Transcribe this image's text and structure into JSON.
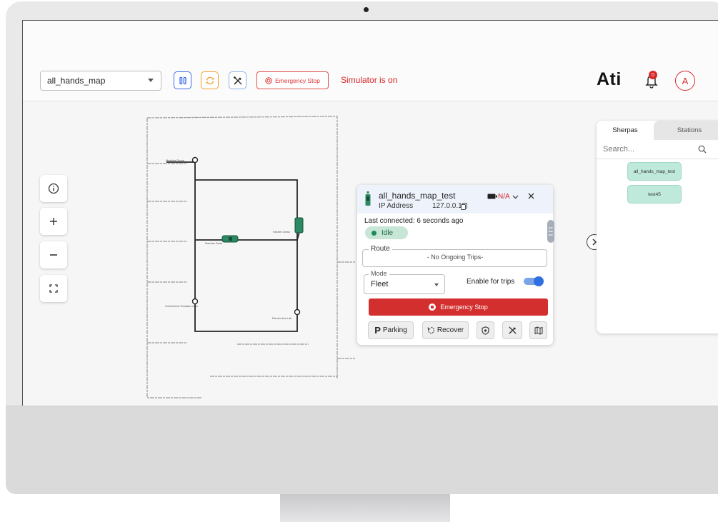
{
  "header": {
    "map_name": "all_hands_map",
    "emergency_stop_label": "Emergency Stop",
    "simulator_status": "Simulator is on",
    "logo": "Ati",
    "notification_count": "0",
    "avatar_initial": "A"
  },
  "map": {
    "labels": [
      "Meeting Room",
      "Kitchen Desk",
      "Nandan Desk",
      "Conference Room",
      "Electronics Lab"
    ]
  },
  "sherpa_card": {
    "name": "all_hands_map_test",
    "ip_label": "IP Address",
    "ip_value": "127.0.0.1",
    "battery": "N/A",
    "last_connected": "Last connected: 6 seconds ago",
    "status": "Idle",
    "route_label": "Route",
    "route_value": "- No Ongoing Trips-",
    "mode_label": "Mode",
    "mode_value": "Fleet",
    "enable_trips_label": "Enable for trips",
    "enable_trips_on": true,
    "emergency_stop_label": "Emergency Stop",
    "parking_label": "Parking",
    "recover_label": "Recover"
  },
  "panel": {
    "tabs": [
      "Sherpas",
      "Stations"
    ],
    "active_tab": "Sherpas",
    "search_placeholder": "Search...",
    "sherpas": [
      "all_hands_map_test",
      "test45"
    ]
  },
  "colors": {
    "accent_red": "#d62828",
    "accent_blue": "#2f6fe0",
    "idle_green": "#1b8a5a",
    "chip_green": "#bfe9da"
  }
}
